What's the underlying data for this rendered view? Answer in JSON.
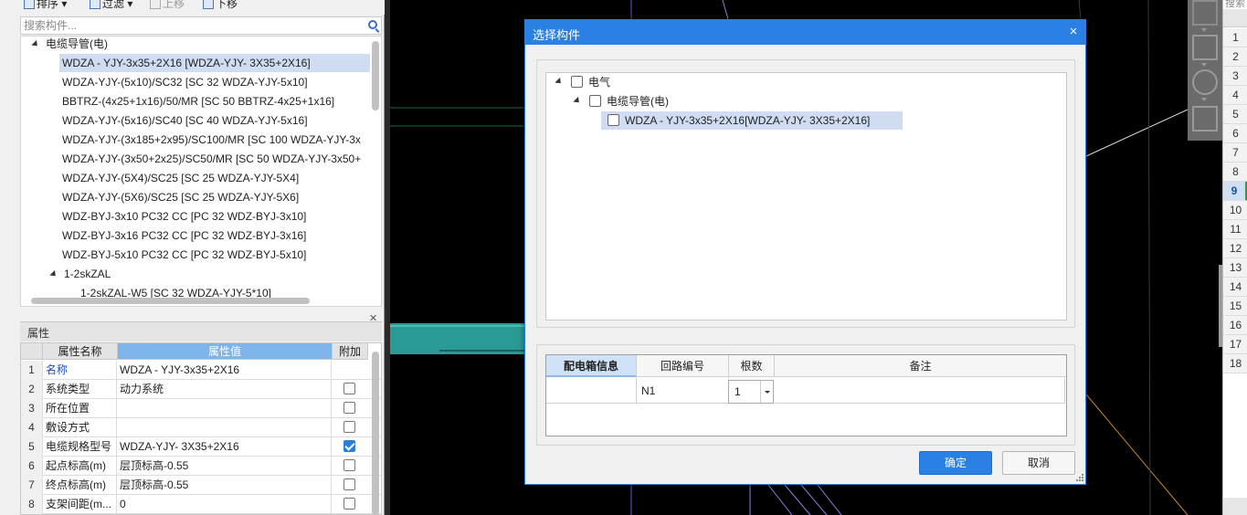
{
  "toolbar": {
    "sort_label": "排序",
    "filter_label": "过滤",
    "move_up_label": "上移",
    "move_down_label": "下移"
  },
  "search": {
    "placeholder": "搜索构件..."
  },
  "tree": {
    "root_label": "电缆导管(电)",
    "items": [
      "WDZA - YJY-3x35+2X16 [WDZA-YJY- 3X35+2X16]",
      "WDZA-YJY-(5x10)/SC32 [SC 32 WDZA-YJY-5x10]",
      "BBTRZ-(4x25+1x16)/50/MR [SC 50 BBTRZ-4x25+1x16]",
      "WDZA-YJY-(5x16)/SC40 [SC 40 WDZA-YJY-5x16]",
      "WDZA-YJY-(3x185+2x95)/SC100/MR [SC 100 WDZA-YJY-3x",
      "WDZA-YJY-(3x50+2x25)/SC50/MR [SC 50 WDZA-YJY-3x50+",
      "WDZA-YJY-(5X4)/SC25 [SC 25 WDZA-YJY-5X4]",
      "WDZA-YJY-(5X6)/SC25 [SC 25 WDZA-YJY-5X6]",
      "WDZ-BYJ-3x10 PC32 CC [PC 32 WDZ-BYJ-3x10]",
      "WDZ-BYJ-3x16 PC32 CC [PC 32 WDZ-BYJ-3x16]",
      "WDZ-BYJ-5x10 PC32 CC [PC 32 WDZ-BYJ-5x10]"
    ],
    "group2_label": "1-2skZAL",
    "group2_first": "1-2skZAL-W5 [SC 32 WDZA-YJY-5*10]"
  },
  "properties": {
    "title": "属性",
    "col_name": "属性名称",
    "col_value": "属性值",
    "col_extra": "附加",
    "rows": [
      {
        "n": "1",
        "name": "名称",
        "value": "WDZA - YJY-3x35+2X16",
        "checked": null
      },
      {
        "n": "2",
        "name": "系统类型",
        "value": "动力系统",
        "checked": false
      },
      {
        "n": "3",
        "name": "所在位置",
        "value": "",
        "checked": false
      },
      {
        "n": "4",
        "name": "敷设方式",
        "value": "",
        "checked": false
      },
      {
        "n": "5",
        "name": "电缆规格型号",
        "value": "WDZA-YJY- 3X35+2X16",
        "checked": true
      },
      {
        "n": "6",
        "name": "起点标高(m)",
        "value": "层顶标高-0.55",
        "checked": false
      },
      {
        "n": "7",
        "name": "终点标高(m)",
        "value": "层顶标高-0.55",
        "checked": false
      },
      {
        "n": "8",
        "name": "支架间距(m...",
        "value": "0",
        "checked": false
      }
    ]
  },
  "row_panel": {
    "search_text": "搜索",
    "rows": [
      "1",
      "2",
      "3",
      "4",
      "5",
      "6",
      "7",
      "8",
      "9",
      "10",
      "11",
      "12",
      "13",
      "14",
      "15",
      "16",
      "17",
      "18"
    ],
    "active": "9"
  },
  "dialog": {
    "title": "选择构件",
    "close_glyph": "×",
    "tree": [
      {
        "label": "电气",
        "level": 0
      },
      {
        "label": "电缆导管(电)",
        "level": 1
      },
      {
        "label": "WDZA - YJY-3x35+2X16[WDZA-YJY- 3X35+2X16]",
        "level": 2
      }
    ],
    "grid": {
      "headers": [
        "配电箱信息",
        "回路编号",
        "根数",
        "备注"
      ],
      "row": {
        "box_info": "",
        "circuit": "N1",
        "count": "1",
        "note": ""
      }
    },
    "ok_label": "确定",
    "cancel_label": "取消"
  },
  "colors": {
    "dialog_accent": "#2b80e4",
    "canvas_bg": "#000000",
    "teal_member": "#2a9a96",
    "purple_lines": "#6b4fd8",
    "orange_line": "#c8832a"
  }
}
